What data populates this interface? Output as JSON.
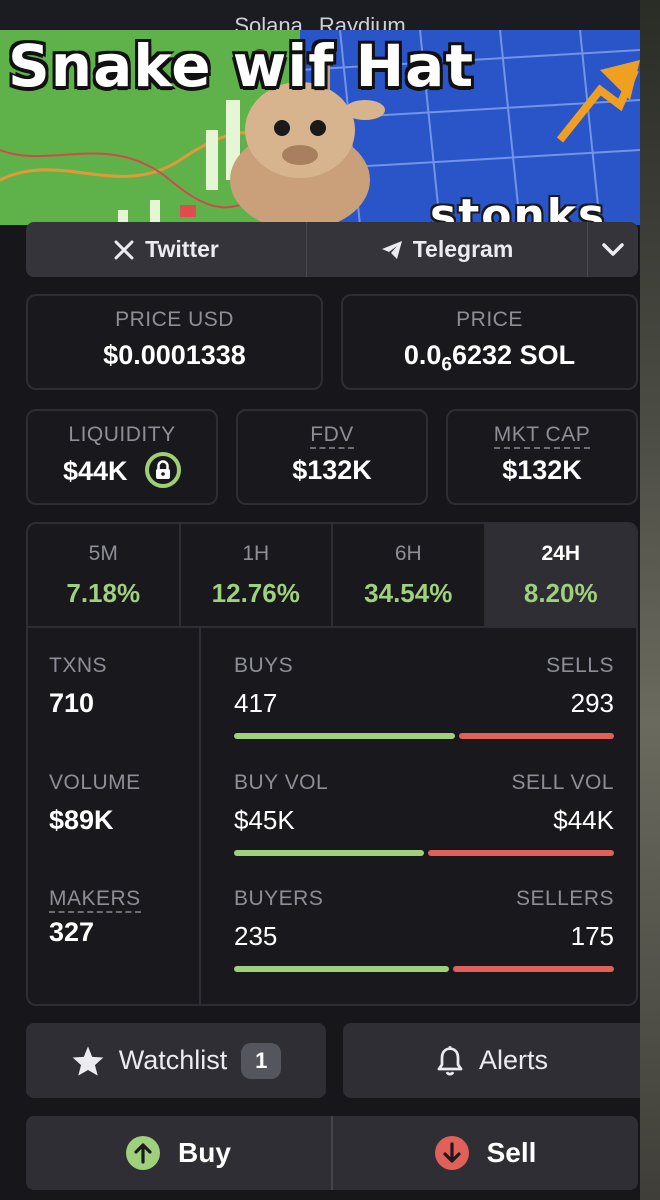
{
  "chain_strip": {
    "chain": "Solana",
    "dex": "Raydium"
  },
  "banner": {
    "title": "Snake wif Hat",
    "caption": "stonks"
  },
  "social": {
    "twitter_label": "Twitter",
    "telegram_label": "Telegram",
    "more_icon": "chevron-down-icon"
  },
  "price_usd": {
    "label": "PRICE USD",
    "value": "$0.0001338"
  },
  "price_sol": {
    "label": "PRICE",
    "prefix": "0.0",
    "zeros": "6",
    "digits": "6232",
    "unit": "SOL"
  },
  "liquidity": {
    "label": "LIQUIDITY",
    "value": "$44K",
    "icon": "lock-icon"
  },
  "fdv": {
    "label": "FDV",
    "value": "$132K"
  },
  "mkt_cap": {
    "label": "MKT CAP",
    "value": "$132K"
  },
  "timeframes": [
    {
      "label": "5M",
      "change": "7.18%"
    },
    {
      "label": "1H",
      "change": "12.76%"
    },
    {
      "label": "6H",
      "change": "34.54%"
    },
    {
      "label": "24H",
      "change": "8.20%"
    }
  ],
  "active_timeframe": "24H",
  "stats": {
    "txns": {
      "label": "TXNS",
      "value": "710"
    },
    "volume": {
      "label": "VOLUME",
      "value": "$89K"
    },
    "makers": {
      "label": "MAKERS",
      "value": "327"
    },
    "buys": {
      "label": "BUYS",
      "value": "417",
      "sell_label": "SELLS",
      "sell_value": "293",
      "buy_fraction": 0.587
    },
    "buy_vol": {
      "label": "BUY VOL",
      "value": "$45K",
      "sell_label": "SELL VOL",
      "sell_value": "$44K",
      "buy_fraction": 0.506
    },
    "buyers": {
      "label": "BUYERS",
      "value": "235",
      "sell_label": "SELLERS",
      "sell_value": "175",
      "buy_fraction": 0.573
    }
  },
  "colors": {
    "positive": "#9fd07c",
    "negative": "#e0605a",
    "accent_lock": "#9fcf72"
  },
  "actions": {
    "watchlist_label": "Watchlist",
    "watchlist_count": "1",
    "alerts_label": "Alerts",
    "buy_label": "Buy",
    "sell_label": "Sell"
  }
}
